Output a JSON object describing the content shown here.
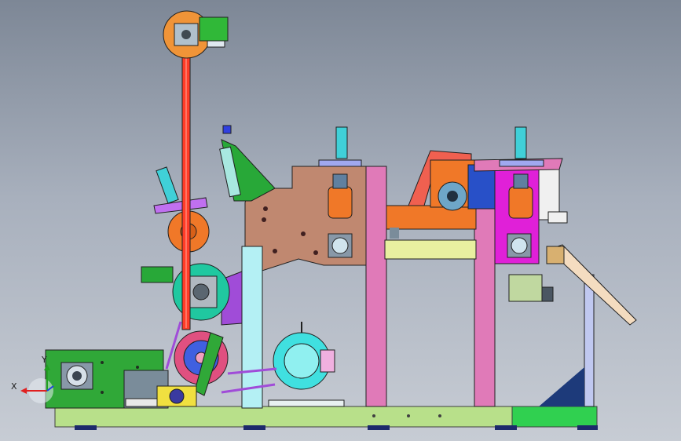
{
  "viewport": {
    "background_top": "#7d8796",
    "background_bottom": "#c7ccd4"
  },
  "colors": {
    "base_frame": "#b8e08a",
    "column_pink": "#e07ab8",
    "column_cyan": "#b4f0f4",
    "frame_magenta": "#e020d8",
    "frame_brown": "#c08870",
    "belt_red": "#ff3c28",
    "orange_part": "#f07828",
    "cyan_motor": "#40e0e0",
    "purple_link": "#a04cd8",
    "dark_green": "#28a838",
    "yellow_part": "#f0e040",
    "blue_part": "#3060e0",
    "slide_tan": "#f4dcc0"
  },
  "axis_triad": {
    "x_label": "X",
    "y_label": "Y"
  }
}
